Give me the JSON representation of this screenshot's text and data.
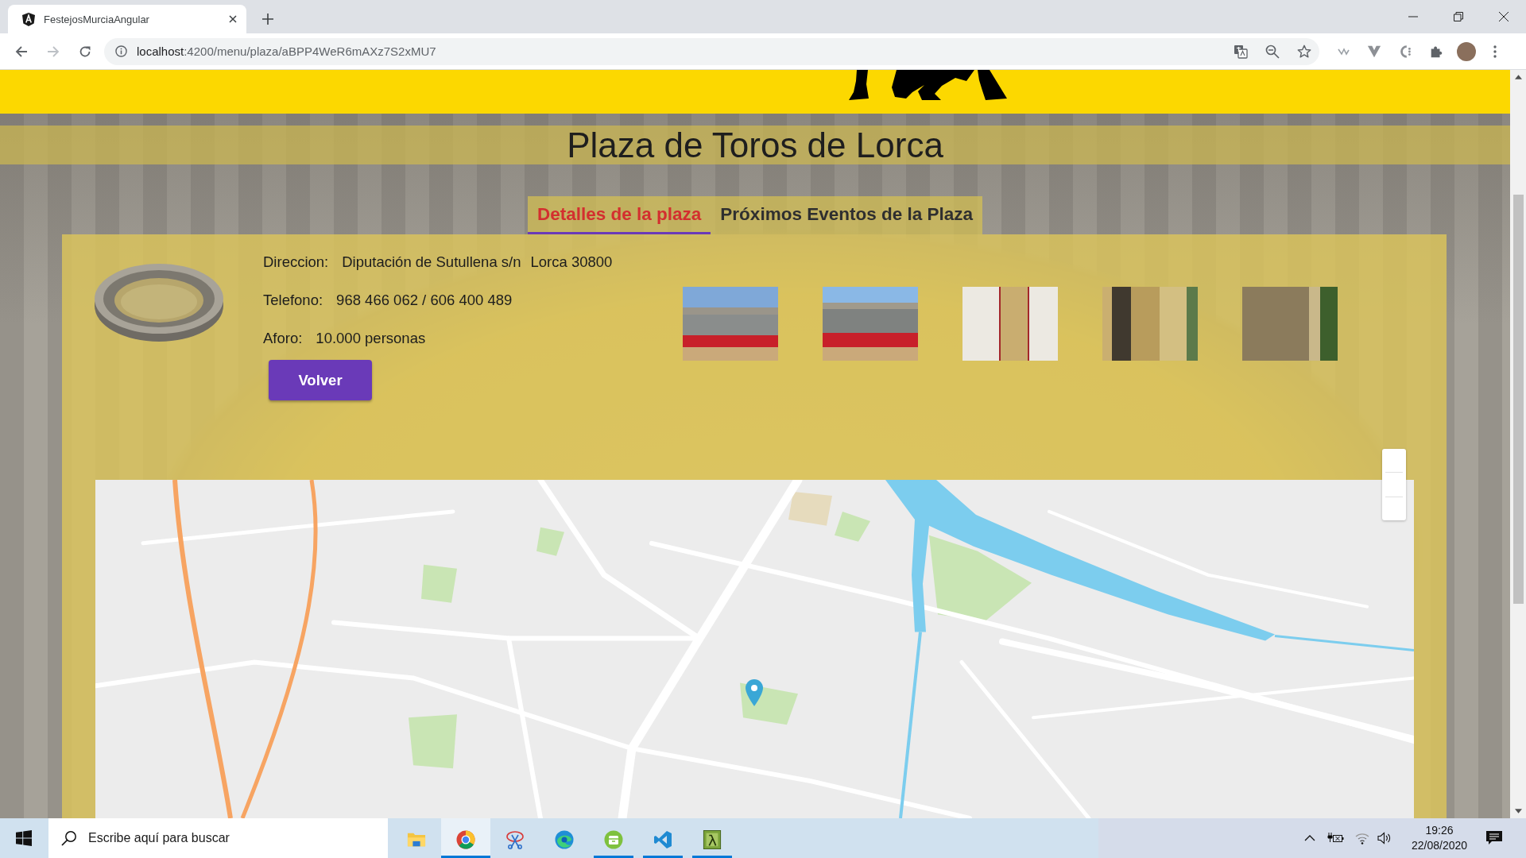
{
  "browser": {
    "tab": {
      "title": "FestejosMurciaAngular"
    },
    "address_bar": {
      "host": "localhost",
      "path": ":4200/menu/plaza/aBPP4WeR6mAXz7S2xMU7"
    }
  },
  "page": {
    "title": "Plaza de Toros de Lorca",
    "tabs": [
      {
        "label": "Detalles de la plaza",
        "selected": true
      },
      {
        "label": "Próximos Eventos de la Plaza",
        "selected": false
      }
    ],
    "details": [
      {
        "label": "Direccion:",
        "values": [
          "Diputación de Sutullena s/n",
          "Lorca 30800"
        ]
      },
      {
        "label": "Telefono:",
        "values": [
          "968 466 062 / 606 400 489"
        ]
      },
      {
        "label": "Aforo:",
        "values": [
          "10.000 personas"
        ]
      }
    ],
    "back_button": "Volver"
  },
  "taskbar": {
    "search": {
      "placeholder": "Escribe aquí para buscar"
    },
    "apps": [
      {
        "running": false,
        "selected": false
      },
      {
        "running": true,
        "selected": true
      },
      {
        "running": false,
        "selected": false
      },
      {
        "running": false,
        "selected": false
      },
      {
        "running": true,
        "selected": false
      },
      {
        "running": true,
        "selected": false
      },
      {
        "running": true,
        "selected": false
      }
    ],
    "clock": {
      "time": "19:26",
      "date": "22/08/2020"
    }
  }
}
